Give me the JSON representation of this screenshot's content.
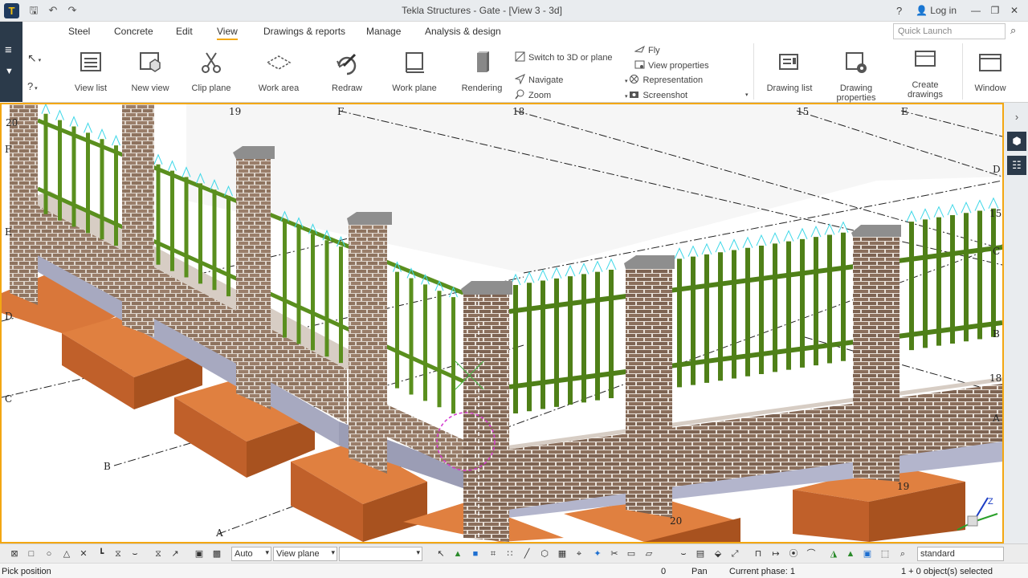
{
  "app": {
    "title": "Tekla Structures - Gate  - [View 3 - 3d]",
    "help": "?",
    "login": "Log in",
    "logo_glyph": "T"
  },
  "quick_access": {
    "save_icon": "save-icon",
    "undo_icon": "undo-icon",
    "redo_icon": "redo-icon"
  },
  "tabs": [
    "Steel",
    "Concrete",
    "Edit",
    "View",
    "Drawings & reports",
    "Manage",
    "Analysis & design"
  ],
  "active_tab": "View",
  "quick_launch": {
    "placeholder": "Quick Launch"
  },
  "ribbon": {
    "view_list": "View list",
    "new_view": "New view",
    "clip_plane": "Clip plane",
    "work_area": "Work area",
    "redraw": "Redraw",
    "work_plane": "Work plane",
    "rendering": "Rendering",
    "switch_3d": "Switch to 3D or plane",
    "navigate": "Navigate",
    "zoom": "Zoom",
    "fly": "Fly",
    "view_properties": "View properties",
    "representation": "Representation",
    "screenshot": "Screenshot",
    "drawing_list": "Drawing list",
    "drawing_properties": "Drawing properties",
    "create_drawings": "Create drawings",
    "window": "Window"
  },
  "grid_labels": {
    "g20_top": "20",
    "g19_top": "19",
    "f_top": "F",
    "g18_top": "18",
    "g15_top": "15",
    "e_top": "E",
    "f_left": "F",
    "e_left": "E",
    "d_left": "D",
    "c_left": "C",
    "b_left": "B",
    "a_left": "A",
    "d_right": "D",
    "g15_right": "15",
    "c_right": "C",
    "b_right": "B",
    "g18_right": "18",
    "a_right": "A",
    "g19_bottom": "19",
    "g20_bottom": "20"
  },
  "colors": {
    "accent": "#f3a712",
    "brick": "#8b6f5c",
    "mortar": "#e8e0d8",
    "fence": "#5a8f1e",
    "footing": "#c8662a",
    "spikes": "#3fd8e8",
    "rail": "#2b3a4a"
  },
  "bottom_toolbar": {
    "auto_select": "Auto",
    "plane_select": "View plane",
    "third_select": "",
    "standard_select": "standard"
  },
  "status": {
    "prompt": "Pick position",
    "zero": "0",
    "pan": "Pan",
    "phase": "Current phase: 1",
    "selection": "1 + 0 object(s) selected"
  }
}
